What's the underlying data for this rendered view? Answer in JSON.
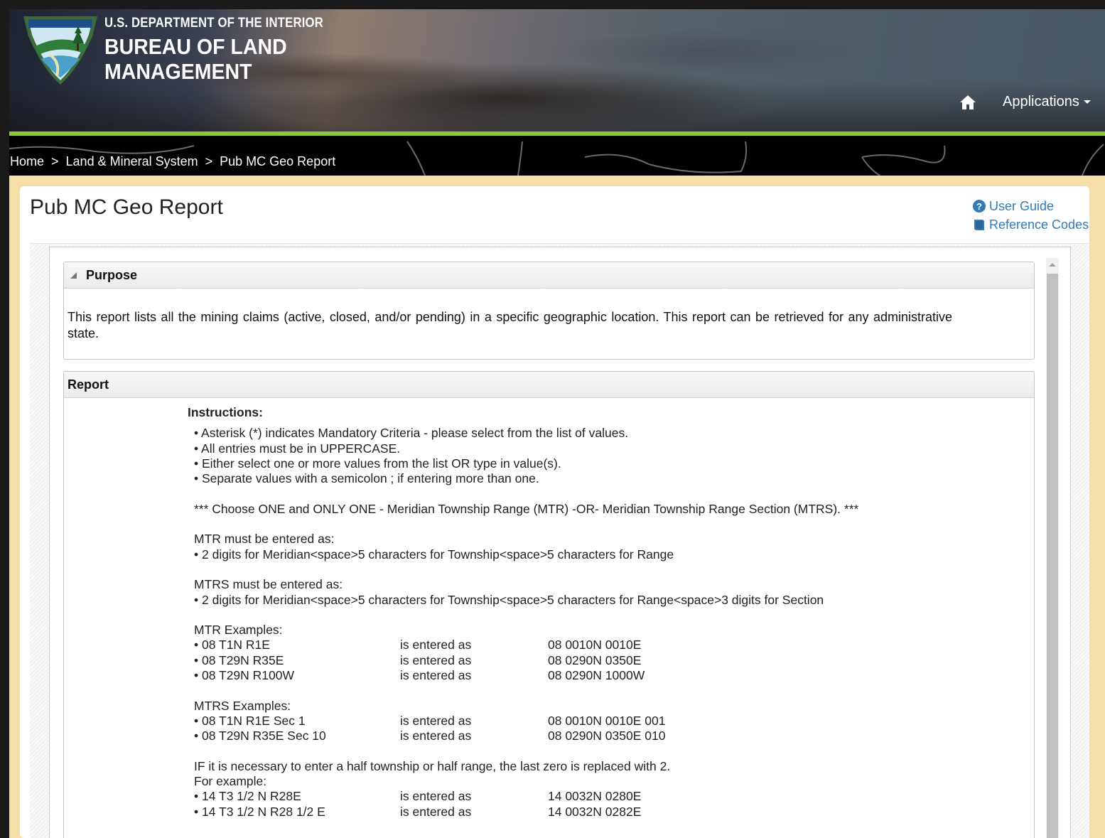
{
  "header": {
    "dept": "U.S. DEPARTMENT OF THE INTERIOR",
    "bureau_line1": "BUREAU OF LAND",
    "bureau_line2": "MANAGEMENT",
    "logo_icon": "blm-shield-logo-icon",
    "home_icon": "home-icon",
    "applications_label": "Applications"
  },
  "breadcrumb": {
    "items": [
      "Home",
      "Land & Mineral System",
      "Pub MC Geo Report"
    ],
    "separator": ">"
  },
  "page": {
    "title": "Pub MC Geo Report",
    "user_guide": "User Guide",
    "reference_codes": "Reference Codes"
  },
  "purpose": {
    "heading": "Purpose",
    "text": "This report lists all the mining claims (active, closed, and/or pending) in a specific geographic location. This report can be retrieved for any administrative state."
  },
  "report": {
    "heading": "Report",
    "instructions_title": "Instructions:",
    "bullets": [
      "• Asterisk (*) indicates Mandatory Criteria - please select from the list of values.",
      "• All entries must be in UPPERCASE.",
      "• Either select one or more values from the list OR type in value(s).",
      "• Separate values with a semicolon ; if entering more than one."
    ],
    "choose_note": "*** Choose ONE and ONLY ONE - Meridian Township Range (MTR) -OR- Meridian Township Range Section (MTRS). ***",
    "mtr_format_title": "MTR must be entered as:",
    "mtr_format": "• 2 digits for Meridian<space>5 characters for Township<space>5 characters for Range",
    "mtrs_format_title": "MTRS must be entered as:",
    "mtrs_format": "• 2 digits for Meridian<space>5 characters for Township<space>5 characters for Range<space>3 digits for Section",
    "mtr_examples_title": "MTR Examples:",
    "mtr_examples": [
      {
        "input": "• 08 T1N  R1E",
        "middle": "is entered as",
        "output": "08 0010N 0010E"
      },
      {
        "input": "• 08 T29N R35E",
        "middle": "is entered as",
        "output": "08 0290N 0350E"
      },
      {
        "input": "• 08 T29N R100W",
        "middle": "is entered as",
        "output": "08 0290N 1000W"
      }
    ],
    "mtrs_examples_title": "MTRS Examples:",
    "mtrs_examples": [
      {
        "input": "• 08 T1N  R1E Sec 1",
        "middle": "is entered as",
        "output": "08 0010N 0010E 001"
      },
      {
        "input": "• 08 T29N R35E Sec 10",
        "middle": "is entered as",
        "output": "08 0290N 0350E 010"
      }
    ],
    "half_note": "IF it is necessary to enter a half township or half range, the last zero is replaced with 2.",
    "for_example": "For example:",
    "half_examples": [
      {
        "input": "• 14 T3 1/2 N R28E",
        "middle": "is entered as",
        "output": "14 0032N 0280E"
      },
      {
        "input": "• 14 T3 1/2 N R28 1/2 E",
        "middle": "is entered as",
        "output": "14 0032N 0282E"
      }
    ]
  },
  "colors": {
    "accent_green": "#8cc63f",
    "link_blue": "#337ab7",
    "page_tan": "#f5dfa6"
  }
}
